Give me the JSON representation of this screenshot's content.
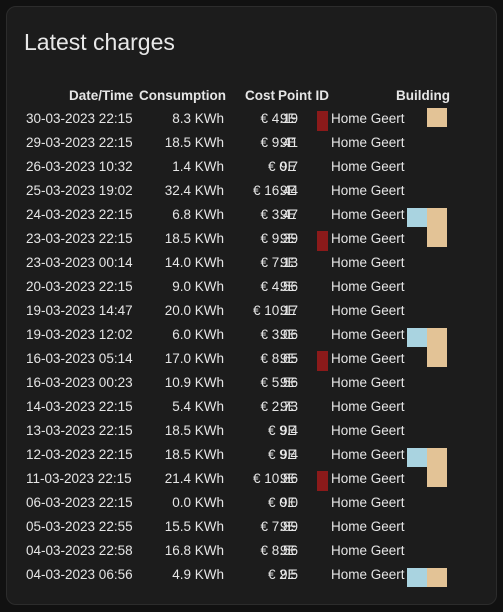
{
  "title": "Latest charges",
  "columns": {
    "datetime": "Date/Time",
    "consumption": "Consumption",
    "cost": "Cost",
    "point_id": "Point ID",
    "building": "Building"
  },
  "colors": {
    "red": "#8b1a1a",
    "blue": "#a9d3e0",
    "tan": "#e3c396"
  },
  "rows": [
    {
      "datetime": "30-03-2023 22:15",
      "consumption": "8.3 KWh",
      "cost": "€ 4.19",
      "point_id": "9E",
      "building": "Home Geert"
    },
    {
      "datetime": "29-03-2023 22:15",
      "consumption": "18.5 KWh",
      "cost": "€ 9.41",
      "point_id": "9E",
      "building": "Home Geert"
    },
    {
      "datetime": "26-03-2023 10:32",
      "consumption": "1.4 KWh",
      "cost": "€ 0.7",
      "point_id": "9E",
      "building": "Home Geert"
    },
    {
      "datetime": "25-03-2023 19:02",
      "consumption": "32.4 KWh",
      "cost": "€ 16.44",
      "point_id": "9E",
      "building": "Home Geert"
    },
    {
      "datetime": "24-03-2023 22:15",
      "consumption": "6.8 KWh",
      "cost": "€ 3.47",
      "point_id": "9E",
      "building": "Home Geert"
    },
    {
      "datetime": "23-03-2023 22:15",
      "consumption": "18.5 KWh",
      "cost": "€ 9.39",
      "point_id": "9E",
      "building": "Home Geert"
    },
    {
      "datetime": "23-03-2023 00:14",
      "consumption": "14.0 KWh",
      "cost": "€ 7.13",
      "point_id": "9E",
      "building": "Home Geert"
    },
    {
      "datetime": "20-03-2023 22:15",
      "consumption": "9.0 KWh",
      "cost": "€ 4.56",
      "point_id": "9E",
      "building": "Home Geert"
    },
    {
      "datetime": "19-03-2023 14:47",
      "consumption": "20.0 KWh",
      "cost": "€ 10.17",
      "point_id": "9E",
      "building": "Home Geert"
    },
    {
      "datetime": "19-03-2023 12:02",
      "consumption": "6.0 KWh",
      "cost": "€ 3.06",
      "point_id": "9E",
      "building": "Home Geert"
    },
    {
      "datetime": "16-03-2023 05:14",
      "consumption": "17.0 KWh",
      "cost": "€ 8.65",
      "point_id": "9E",
      "building": "Home Geert"
    },
    {
      "datetime": "16-03-2023 00:23",
      "consumption": "10.9 KWh",
      "cost": "€ 5.56",
      "point_id": "9E",
      "building": "Home Geert"
    },
    {
      "datetime": "14-03-2023 22:15",
      "consumption": "5.4 KWh",
      "cost": "€ 2.73",
      "point_id": "9E",
      "building": "Home Geert"
    },
    {
      "datetime": "13-03-2023 22:15",
      "consumption": "18.5 KWh",
      "cost": "€ 9.4",
      "point_id": "9E",
      "building": "Home Geert"
    },
    {
      "datetime": "12-03-2023 22:15",
      "consumption": "18.5 KWh",
      "cost": "€ 9.4",
      "point_id": "9E",
      "building": "Home Geert"
    },
    {
      "datetime": "11-03-2023 22:15",
      "consumption": "21.4 KWh",
      "cost": "€ 10.86",
      "point_id": "9E",
      "building": "Home Geert"
    },
    {
      "datetime": "06-03-2023 22:15",
      "consumption": "0.0 KWh",
      "cost": "€ 0.0",
      "point_id": "9E",
      "building": "Home Geert"
    },
    {
      "datetime": "05-03-2023 22:55",
      "consumption": "15.5 KWh",
      "cost": "€ 7.89",
      "point_id": "9E",
      "building": "Home Geert"
    },
    {
      "datetime": "04-03-2023 22:58",
      "consumption": "16.8 KWh",
      "cost": "€ 8.56",
      "point_id": "9E",
      "building": "Home Geert"
    },
    {
      "datetime": "04-03-2023 06:56",
      "consumption": "4.9 KWh",
      "cost": "€ 2.5",
      "point_id": "9E",
      "building": "Home Geert"
    }
  ]
}
